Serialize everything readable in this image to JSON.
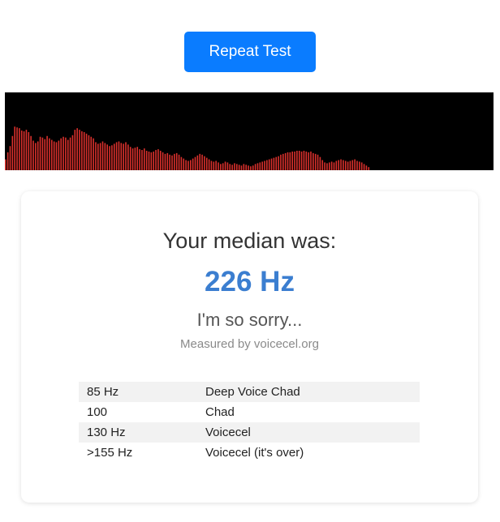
{
  "header": {
    "repeat_button_label": "Repeat Test"
  },
  "visualizer": {
    "bar_color": "#d9302c",
    "background": "#000000",
    "levels": [
      0.14,
      0.23,
      0.31,
      0.44,
      0.56,
      0.55,
      0.54,
      0.51,
      0.5,
      0.52,
      0.49,
      0.44,
      0.38,
      0.35,
      0.37,
      0.43,
      0.42,
      0.4,
      0.44,
      0.41,
      0.39,
      0.37,
      0.36,
      0.38,
      0.41,
      0.43,
      0.42,
      0.39,
      0.42,
      0.45,
      0.52,
      0.54,
      0.52,
      0.5,
      0.49,
      0.47,
      0.45,
      0.43,
      0.41,
      0.36,
      0.34,
      0.35,
      0.37,
      0.35,
      0.33,
      0.31,
      0.32,
      0.34,
      0.36,
      0.37,
      0.35,
      0.34,
      0.36,
      0.33,
      0.3,
      0.28,
      0.29,
      0.3,
      0.27,
      0.26,
      0.28,
      0.25,
      0.24,
      0.23,
      0.24,
      0.26,
      0.27,
      0.25,
      0.23,
      0.21,
      0.22,
      0.2,
      0.19,
      0.21,
      0.22,
      0.2,
      0.17,
      0.15,
      0.13,
      0.12,
      0.13,
      0.15,
      0.17,
      0.19,
      0.21,
      0.2,
      0.18,
      0.16,
      0.14,
      0.12,
      0.11,
      0.12,
      0.1,
      0.08,
      0.09,
      0.11,
      0.1,
      0.08,
      0.07,
      0.09,
      0.08,
      0.07,
      0.06,
      0.08,
      0.07,
      0.06,
      0.05,
      0.06,
      0.08,
      0.09,
      0.1,
      0.11,
      0.12,
      0.13,
      0.14,
      0.15,
      0.16,
      0.17,
      0.18,
      0.2,
      0.21,
      0.22,
      0.23,
      0.23,
      0.24,
      0.24,
      0.25,
      0.25,
      0.24,
      0.25,
      0.24,
      0.23,
      0.24,
      0.22,
      0.21,
      0.2,
      0.17,
      0.13,
      0.1,
      0.09,
      0.1,
      0.11,
      0.1,
      0.12,
      0.13,
      0.14,
      0.13,
      0.12,
      0.11,
      0.12,
      0.13,
      0.14,
      0.12,
      0.11,
      0.1,
      0.08,
      0.06,
      0.04,
      0.0
    ]
  },
  "result": {
    "median_label": "Your median was:",
    "median_value": "226 Hz",
    "verdict": "I'm so sorry...",
    "credit": "Measured by voicecel.org"
  },
  "reference_table": [
    {
      "freq": "85 Hz",
      "label": "Deep Voice Chad"
    },
    {
      "freq": "100",
      "label": "Chad"
    },
    {
      "freq": "130 Hz",
      "label": "Voicecel"
    },
    {
      "freq": ">155 Hz",
      "label": "Voicecel (it's over)"
    }
  ]
}
